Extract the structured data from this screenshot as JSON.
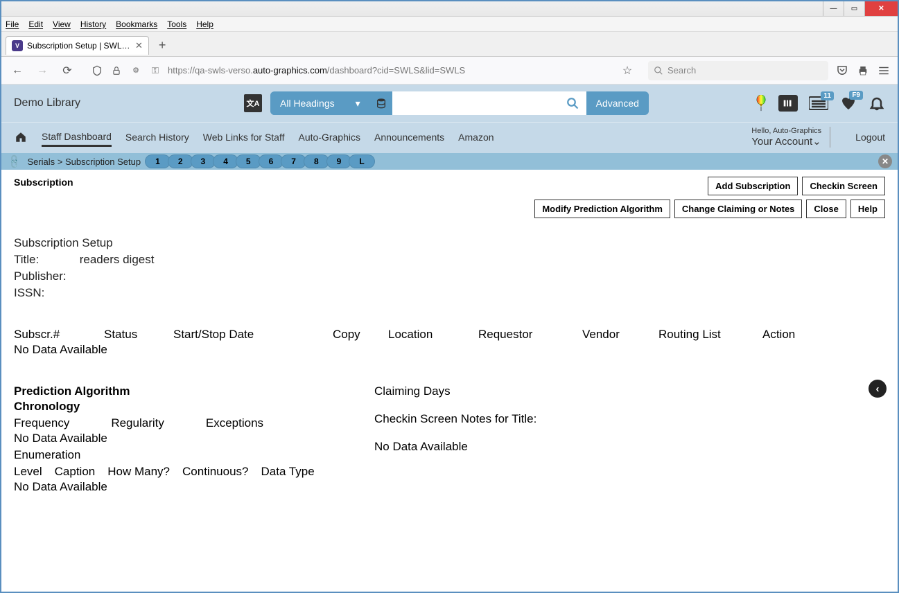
{
  "browser": {
    "menu": [
      "File",
      "Edit",
      "View",
      "History",
      "Bookmarks",
      "Tools",
      "Help"
    ],
    "tab_title": "Subscription Setup | SWLS | swls",
    "url_prefix": "https://qa-swls-verso.",
    "url_domain": "auto-graphics.com",
    "url_suffix": "/dashboard?cid=SWLS&lid=SWLS",
    "search_placeholder": "Search"
  },
  "header": {
    "library_name": "Demo Library",
    "headings_label": "All Headings",
    "advanced_label": "Advanced",
    "list_badge": "11",
    "heart_badge": "F9"
  },
  "nav": {
    "links": [
      "Staff Dashboard",
      "Search History",
      "Web Links for Staff",
      "Auto-Graphics",
      "Announcements",
      "Amazon"
    ],
    "hello": "Hello, Auto-Graphics",
    "account": "Your Account",
    "logout": "Logout"
  },
  "crumb": {
    "text": "Serials > Subscription Setup",
    "pages": [
      "1",
      "2",
      "3",
      "4",
      "5",
      "6",
      "7",
      "8",
      "9",
      "L"
    ]
  },
  "page": {
    "title": "Subscription",
    "buttons_row1": [
      "Add Subscription",
      "Checkin Screen"
    ],
    "buttons_row2": [
      "Modify Prediction Algorithm",
      "Change Claiming or Notes",
      "Close",
      "Help"
    ]
  },
  "setup": {
    "heading": "Subscription Setup",
    "title_label": "Title:",
    "title_value": "readers digest",
    "publisher_label": "Publisher:",
    "issn_label": "ISSN:"
  },
  "sub_table": {
    "headers": [
      "Subscr.#",
      "Status",
      "Start/Stop Date",
      "Copy",
      "Location",
      "Requestor",
      "Vendor",
      "Routing List",
      "Action"
    ],
    "no_data": "No Data Available"
  },
  "prediction": {
    "title": "Prediction Algorithm",
    "chronology": "Chronology",
    "chron_headers": [
      "Frequency",
      "Regularity",
      "Exceptions"
    ],
    "chron_no_data": "No Data Available",
    "enumeration": "Enumeration",
    "enum_headers": [
      "Level",
      "Caption",
      "How Many?",
      "Continuous?",
      "Data Type"
    ],
    "enum_no_data": "No Data Available",
    "claiming_days": "Claiming Days",
    "checkin_notes": "Checkin Screen Notes for Title:",
    "checkin_no_data": "No Data Available"
  }
}
